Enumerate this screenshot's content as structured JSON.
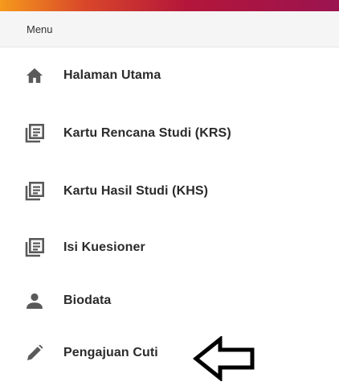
{
  "header": {
    "title": "Menu"
  },
  "menu": {
    "items": [
      {
        "label": "Halaman Utama",
        "icon": "home-icon"
      },
      {
        "label": "Kartu Rencana Studi (KRS)",
        "icon": "list-document-icon"
      },
      {
        "label": "Kartu Hasil Studi (KHS)",
        "icon": "list-document-icon"
      },
      {
        "label": "Isi Kuesioner",
        "icon": "list-document-icon"
      },
      {
        "label": "Biodata",
        "icon": "person-icon"
      },
      {
        "label": "Pengajuan Cuti",
        "icon": "pencil-icon"
      }
    ]
  },
  "colors": {
    "icon": "#5a5a5a",
    "text": "#2b2b2b",
    "header_bg": "#f5f5f5"
  }
}
